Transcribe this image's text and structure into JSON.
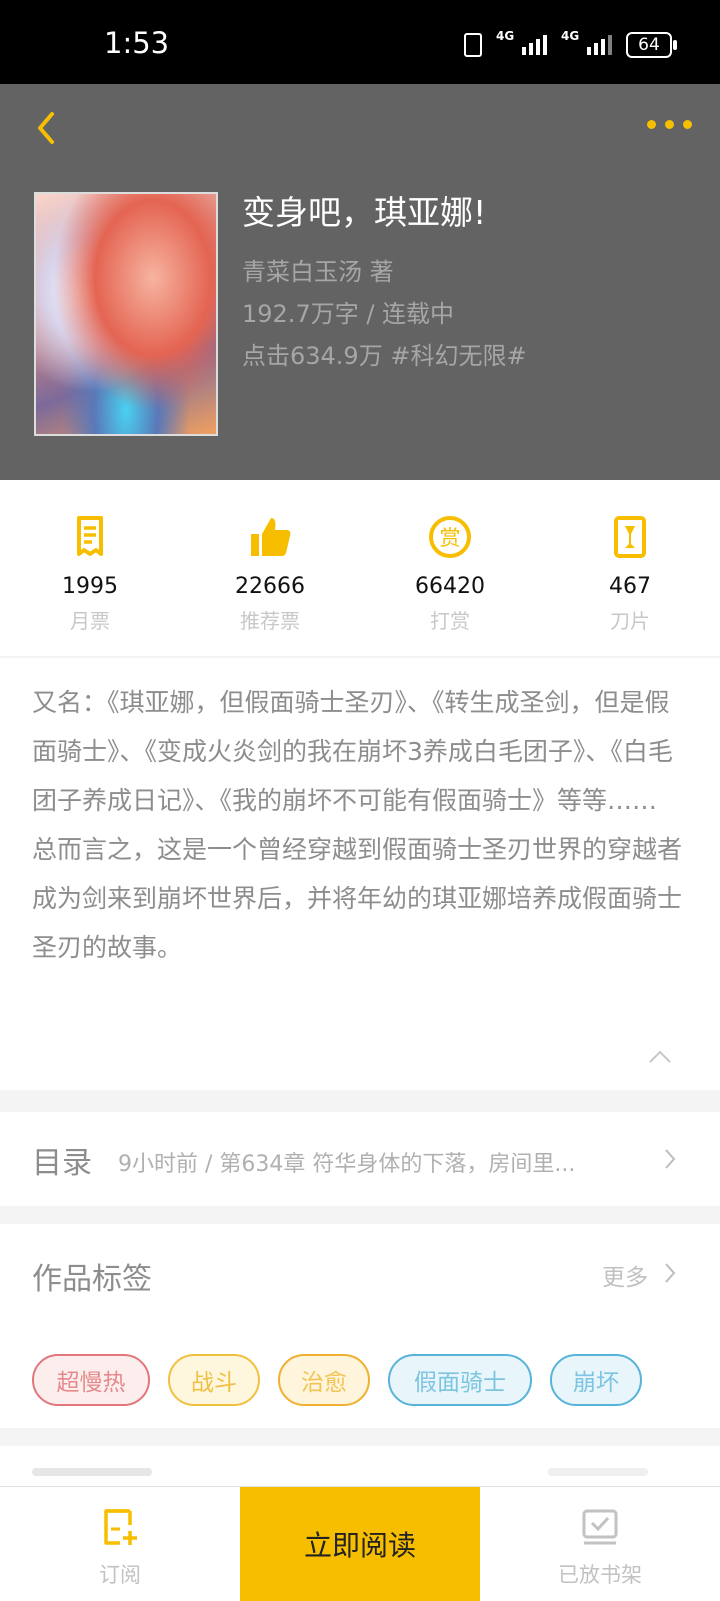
{
  "status_bar": {
    "time": "1:53",
    "network_1": "4G",
    "network_2": "4G",
    "battery": "64"
  },
  "book": {
    "title": "变身吧，琪亚娜!",
    "author_line": "青菜白玉汤  著",
    "words_status": "192.7万字 / 连载中",
    "clicks_tag": "点击634.9万  #科幻无限#"
  },
  "stats": [
    {
      "icon": "monthly-ticket-icon",
      "value": "1995",
      "label": "月票"
    },
    {
      "icon": "thumbs-up-icon",
      "value": "22666",
      "label": "推荐票"
    },
    {
      "icon": "reward-icon",
      "value": "66420",
      "label": "打赏"
    },
    {
      "icon": "blade-icon",
      "value": "467",
      "label": "刀片"
    }
  ],
  "description": {
    "paragraph_1": "又名：《琪亚娜，但假面骑士圣刃》、《转生成圣剑，但是假面骑士》、《变成火炎剑的我在崩坏3养成白毛团子》、《白毛团子养成日记》、《我的崩坏不可能有假面骑士》等等……",
    "paragraph_2": "总而言之，这是一个曾经穿越到假面骑士圣刃世界的穿越者成为剑来到崩坏世界后，并将年幼的琪亚娜培养成假面骑士圣刃的故事。"
  },
  "toc": {
    "label": "目录",
    "latest": "9小时前 / 第634章 符华身体的下落，房间里..."
  },
  "tags": {
    "title": "作品标签",
    "more": "更多",
    "items": [
      {
        "label": "超慢热",
        "border": "#e2767a",
        "bg": "#fdeeee",
        "color": "#e58a8c"
      },
      {
        "label": "战斗",
        "border": "#f0c040",
        "bg": "#fff6de",
        "color": "#f0c040"
      },
      {
        "label": "治愈",
        "border": "#f0b030",
        "bg": "#fff4dc",
        "color": "#f2c456"
      },
      {
        "label": "假面骑士",
        "border": "#57b4d8",
        "bg": "#e8f6fc",
        "color": "#7cc4e0"
      },
      {
        "label": "崩坏",
        "border": "#57b4d8",
        "bg": "#e8f6fc",
        "color": "#7cc4e0"
      }
    ]
  },
  "bottom_bar": {
    "subscribe": "订阅",
    "read_now": "立即阅读",
    "on_shelf": "已放书架"
  },
  "colors": {
    "accent": "#f7be00",
    "header_bg": "#636363"
  }
}
